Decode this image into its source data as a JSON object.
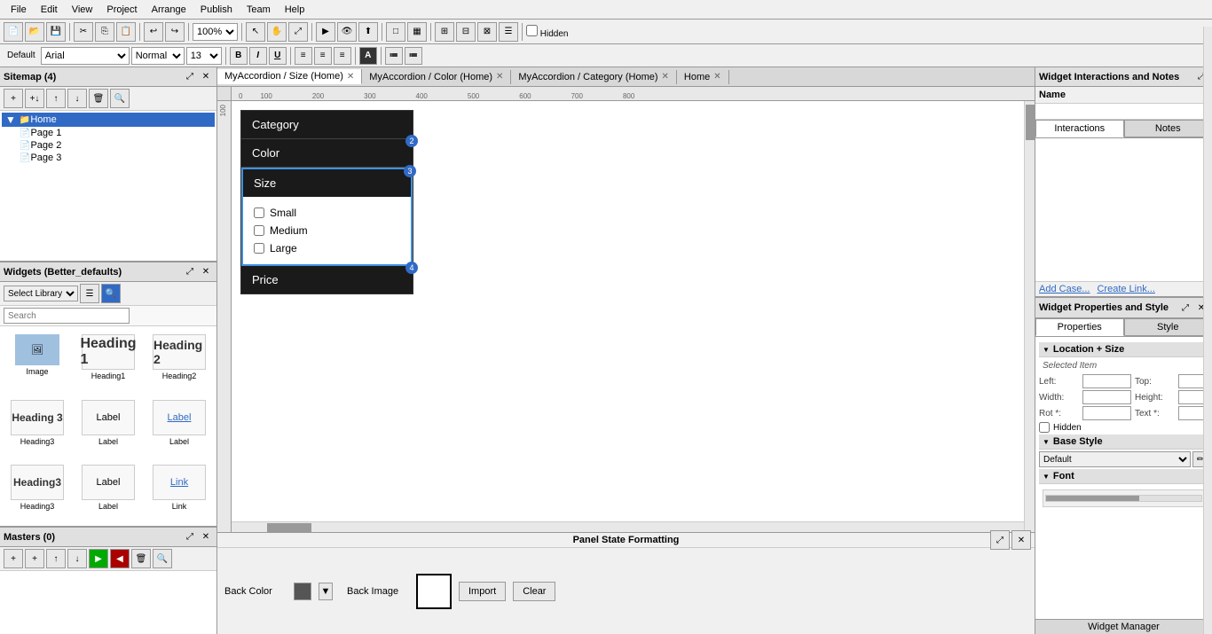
{
  "menubar": {
    "items": [
      "File",
      "Edit",
      "View",
      "Project",
      "Arrange",
      "Publish",
      "Team",
      "Help"
    ]
  },
  "toolbar": {
    "zoom": "100%",
    "hidden_label": "Hidden"
  },
  "format_bar": {
    "font": "Arial",
    "style": "Normal",
    "size": "13",
    "bold": "B",
    "italic": "I",
    "underline": "U"
  },
  "sitemap": {
    "title": "Sitemap (4)",
    "items": [
      {
        "label": "Home",
        "type": "folder",
        "level": 0
      },
      {
        "label": "Page 1",
        "type": "page",
        "level": 1
      },
      {
        "label": "Page 2",
        "type": "page",
        "level": 1
      },
      {
        "label": "Page 3",
        "type": "page",
        "level": 1
      }
    ]
  },
  "widgets": {
    "title": "Widgets (Better_defaults)",
    "search_placeholder": "Search",
    "items": [
      {
        "label": "Image",
        "type": "image"
      },
      {
        "label": "Heading1",
        "type": "heading1"
      },
      {
        "label": "Heading2",
        "type": "heading2"
      },
      {
        "label": "Heading3",
        "type": "heading3"
      },
      {
        "label": "Label",
        "type": "label"
      },
      {
        "label": "Label",
        "type": "label-blue"
      },
      {
        "label": "Heading3",
        "type": "heading3-2"
      },
      {
        "label": "Label",
        "type": "label2"
      },
      {
        "label": "Link",
        "type": "link"
      }
    ]
  },
  "masters": {
    "title": "Masters (0)"
  },
  "tabs": [
    {
      "label": "MyAccordion / Size (Home)",
      "active": true
    },
    {
      "label": "MyAccordion / Color (Home)",
      "active": false
    },
    {
      "label": "MyAccordion / Category (Home)",
      "active": false
    },
    {
      "label": "Home",
      "active": false
    }
  ],
  "canvas": {
    "accordion": {
      "items": [
        {
          "label": "Category",
          "badge": null
        },
        {
          "label": "Color",
          "badge": "2"
        },
        {
          "label": "Size",
          "badge": "3",
          "expanded": true
        },
        {
          "label": "Price",
          "badge": "4"
        }
      ],
      "size_options": [
        "Small",
        "Medium",
        "Large"
      ]
    }
  },
  "interactions_panel": {
    "title": "Widget Interactions and Notes",
    "tabs": [
      "Interactions",
      "Notes"
    ],
    "active_tab": "Interactions",
    "add_case": "Add Case...",
    "create_link": "Create Link..."
  },
  "name_label": "Name",
  "properties_panel": {
    "title": "Widget Properties and Style",
    "tabs": [
      "Properties",
      "Style"
    ],
    "active_tab": "Properties",
    "location_size": {
      "title": "Location + Size",
      "selected_item": "Selected Item",
      "left_label": "Left:",
      "top_label": "Top:",
      "width_label": "Width:",
      "height_label": "Height:",
      "rot_label": "Rot *:",
      "text_label": "Text *:",
      "hidden_label": "Hidden"
    },
    "base_style": {
      "title": "Base Style",
      "value": "Default"
    },
    "font": {
      "title": "Font"
    }
  },
  "bottom_area": {
    "title": "Panel State Formatting",
    "back_color_label": "Back Color",
    "back_image_label": "Back Image",
    "import_btn": "Import",
    "clear_btn": "Clear"
  },
  "widget_manager": "Widget Manager"
}
